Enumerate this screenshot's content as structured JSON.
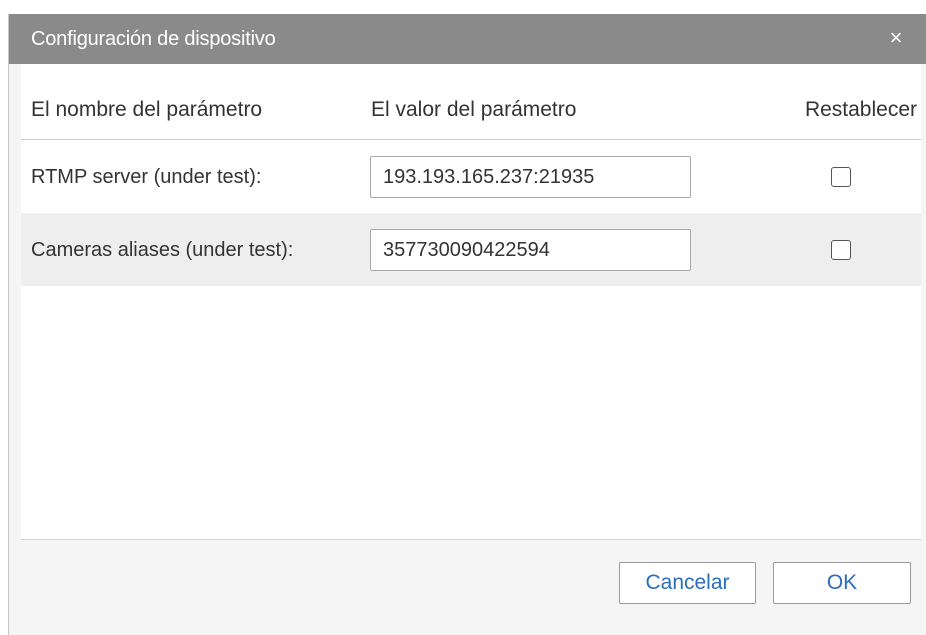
{
  "dialog": {
    "title": "Configuración de dispositivo",
    "close_icon": "×"
  },
  "table": {
    "headers": {
      "name": "El nombre del parámetro",
      "value": "El valor del parámetro",
      "reset": "Restablecer"
    },
    "rows": [
      {
        "label": "RTMP server (under test):",
        "value": "193.193.165.237:21935",
        "reset_checked": false
      },
      {
        "label": "Cameras aliases (under test):",
        "value": "357730090422594",
        "reset_checked": false
      }
    ]
  },
  "footer": {
    "cancel_label": "Cancelar",
    "ok_label": "OK"
  },
  "colors": {
    "titlebar": "#8a8a8a",
    "button_text": "#2a6ebb",
    "alt_row": "#eeeeee"
  }
}
